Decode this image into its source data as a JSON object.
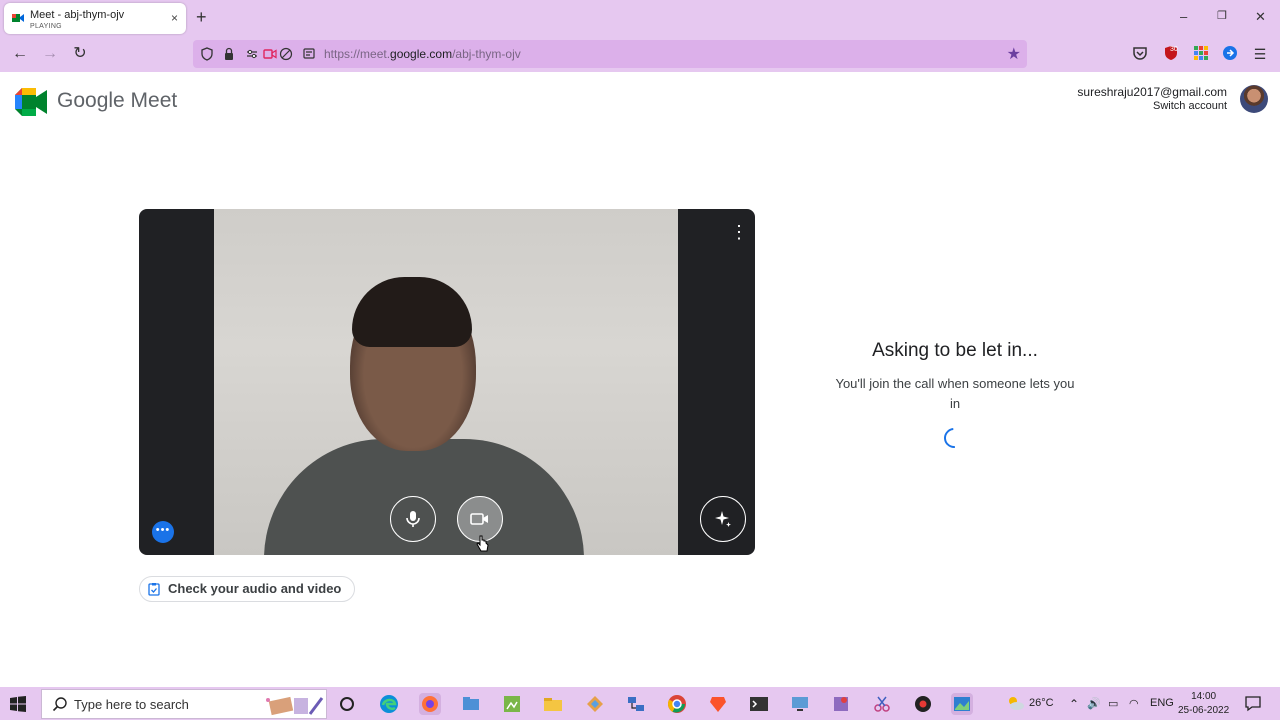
{
  "browser": {
    "tab": {
      "title": "Meet - abj-thym-ojv",
      "subtitle": "PLAYING",
      "close": "×"
    },
    "new_tab": "+",
    "window_controls": {
      "minimize": "–",
      "restore": "❐",
      "close": "✕"
    },
    "nav": {
      "back": "←",
      "forward": "→",
      "reload": "↻"
    },
    "url": {
      "prefix": "https://meet.",
      "domain": "google.com",
      "path": "/abj-thym-ojv"
    }
  },
  "meet": {
    "brand": "Google Meet",
    "account": {
      "email": "sureshraju2017@gmail.com",
      "switch_label": "Switch account"
    },
    "video": {
      "more_options": "⋮",
      "effects_dots": "•••"
    },
    "check_av_label": "Check your audio and video",
    "status_title": "Asking to be let in...",
    "status_subtitle": "You'll join the call when someone lets you in"
  },
  "taskbar": {
    "search_placeholder": "Type here to search",
    "weather": "26°C",
    "language": "ENG",
    "time": "14:00",
    "date": "25-06-2022"
  },
  "colors": {
    "chrome": "#e6c8f0",
    "url_bar": "#dcb0ea",
    "accent_blue": "#1a73e8",
    "video_bg": "#202124"
  }
}
